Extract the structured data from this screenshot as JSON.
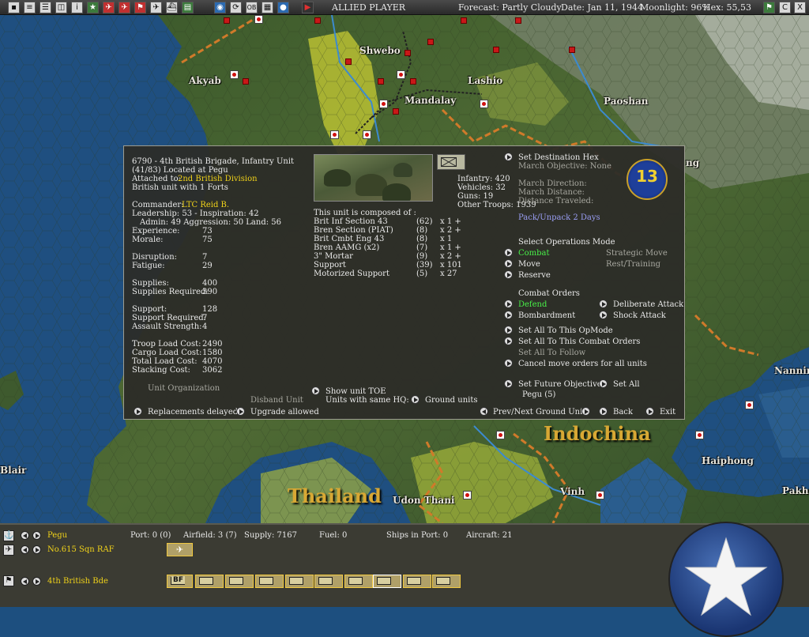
{
  "topbar": {
    "player": "ALLIED PLAYER",
    "forecast": "Forecast: Partly Cloudy",
    "date": "Date: Jan 11, 1944",
    "moonlight": "Moonlight: 96%",
    "hex": "Hex: 55,53",
    "icons": [
      "save-icon",
      "report-icon",
      "list-icon",
      "intel-icon",
      "info-icon",
      "star-icon",
      "air-icon",
      "fleet-icon",
      "flag-icon",
      "plane-icon",
      "ship-icon",
      "map-icon",
      "globe-icon",
      "refresh-icon",
      "ob-icon",
      "keyboard-icon",
      "pause-icon",
      "play-icon"
    ],
    "ob_label": "OB",
    "right_c": "C",
    "right_x": "X"
  },
  "map_labels": {
    "akyab": "Akyab",
    "shwebo": "Shwebo",
    "lashio": "Lashio",
    "mandalay": "Mandalay",
    "paoshan": "Paoshan",
    "indochina": "Indochina",
    "thailand": "Thailand",
    "udon_thani": "Udon Thani",
    "haiphong": "Haiphong",
    "vinh": "Vinh",
    "nanning": "Nanning",
    "pakhoi": "Pakho",
    "blair": "Blair",
    "ng": "ng"
  },
  "dialog": {
    "header": {
      "line1": "6790 - 4th British Brigade, Infantry Unit",
      "line2": "(41/83) Located at Pegu",
      "attached_label": "Attached to:",
      "attached_value": "2nd British Division",
      "line4": "British unit with 1 Forts"
    },
    "commander_label": "Commander:",
    "commander_value": "LTC Reid B.",
    "leadership": "Leadership: 53 - Inspiration: 42",
    "admin": "Admin: 49  Aggression: 50  Land: 56",
    "stats": [
      {
        "label": "Experience:",
        "value": "73"
      },
      {
        "label": "Morale:",
        "value": "75"
      },
      {
        "label": "Disruption:",
        "value": "7"
      },
      {
        "label": "Fatigue:",
        "value": "29"
      },
      {
        "label": "Supplies:",
        "value": "400"
      },
      {
        "label": "Supplies Required:",
        "value": "390"
      },
      {
        "label": "Support:",
        "value": "128"
      },
      {
        "label": "Support Required:",
        "value": "7"
      },
      {
        "label": "Assault Strength:",
        "value": "4"
      },
      {
        "label": "Troop Load Cost:",
        "value": "2490"
      },
      {
        "label": "Cargo Load Cost:",
        "value": "1580"
      },
      {
        "label": "Total Load Cost:",
        "value": "4070"
      },
      {
        "label": "Stacking Cost:",
        "value": "3062"
      }
    ],
    "unit_org": "Unit Organization",
    "disband": "Disband Unit",
    "replacements": "Replacements delayed",
    "upgrade": "Upgrade allowed",
    "show_toe": "Show unit TOE",
    "same_hq": "Units with same HQ:",
    "ground_units": "Ground units",
    "troops": {
      "infantry": "Infantry: 420",
      "vehicles": "Vehicles: 32",
      "guns": "Guns: 19",
      "other": "Other Troops: 1939"
    },
    "composed_label": "This unit is composed of :",
    "composition": [
      {
        "name": "Brit Inf Section 43",
        "num": "(62)",
        "mult": "x 1 +"
      },
      {
        "name": "Bren Section (PIAT)",
        "num": "(8)",
        "mult": "x 2 +"
      },
      {
        "name": "Brit Cmbt Eng 43",
        "num": "(8)",
        "mult": "x 1"
      },
      {
        "name": "Bren AAMG (x2)",
        "num": "(7)",
        "mult": "x 1 +"
      },
      {
        "name": "3\" Mortar",
        "num": "(9)",
        "mult": "x 2 +"
      },
      {
        "name": "Support",
        "num": "(39)",
        "mult": "x 101"
      },
      {
        "name": "Motorized Support",
        "num": "(5)",
        "mult": "x 27"
      }
    ],
    "dest_hex": "Set Destination Hex",
    "march_objective": "March Objective: None",
    "march_direction": "March Direction:",
    "march_distance": "March Distance:",
    "distance_traveled": "Distance Traveled:",
    "emblem_text": "13",
    "pack": "Pack/Unpack 2 Days",
    "ops_mode_label": "Select Operations Mode",
    "ops": {
      "combat": "Combat",
      "strategic": "Strategic Move",
      "move": "Move",
      "rest": "Rest/Training",
      "reserve": "Reserve"
    },
    "combat_orders_label": "Combat Orders",
    "orders": {
      "defend": "Defend",
      "deliberate": "Deliberate Attack",
      "bombardment": "Bombardment",
      "shock": "Shock Attack"
    },
    "set_all_opmode": "Set All To This OpMode",
    "set_all_combat": "Set All To This Combat Orders",
    "set_all_follow": "Set All To Follow",
    "cancel_move": "Cancel move orders for all units",
    "future_obj": "Set Future Objective",
    "set_all": "Set All",
    "future_value": "Pegu (5)",
    "prev_next": "Prev/Next Ground Unit",
    "back": "Back",
    "exit": "Exit"
  },
  "bottom": {
    "location": "Pegu",
    "port": "Port: 0 (0)",
    "airfield": "Airfield: 3 (7)",
    "supply": "Supply: 7167",
    "fuel": "Fuel: 0",
    "ships": "Ships in Port: 0",
    "aircraft": "Aircraft: 21",
    "air_unit": "No.615 Sqn RAF",
    "ground_unit": "4th British Bde",
    "bf_label": "BF"
  }
}
